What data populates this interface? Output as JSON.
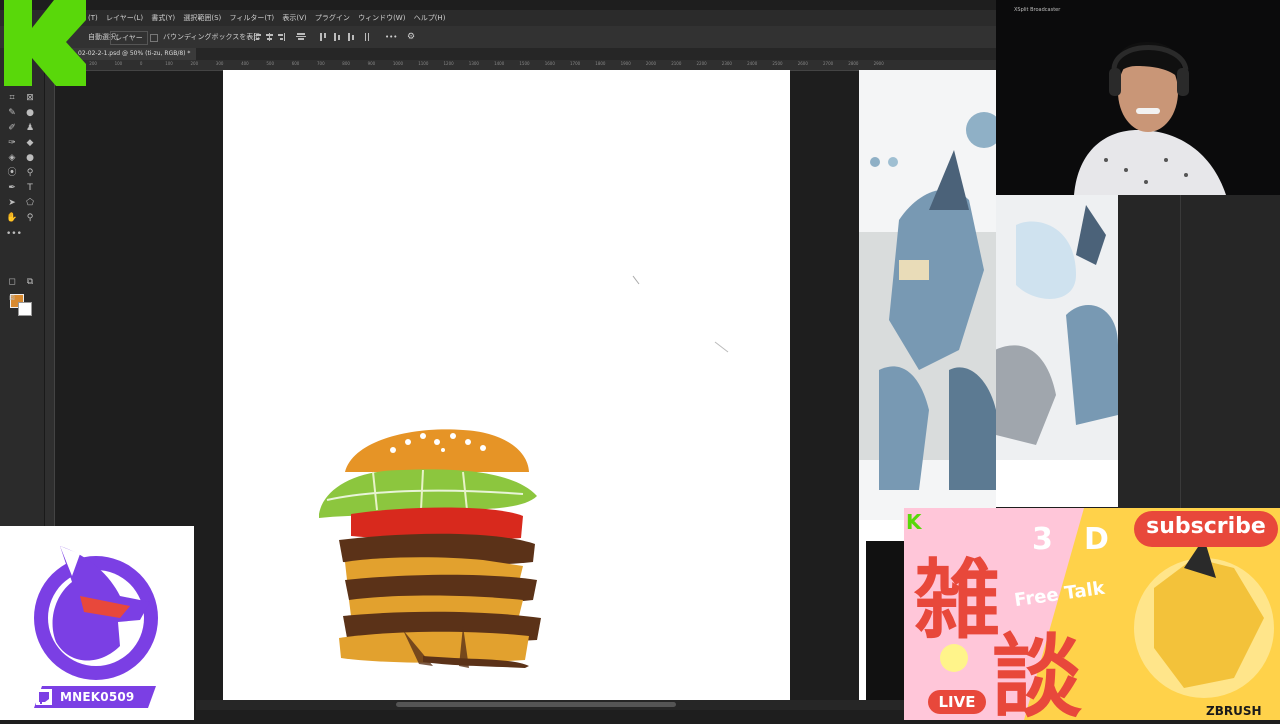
{
  "menu": {
    "items": [
      "(T)",
      "レイヤー(L)",
      "書式(Y)",
      "選択範囲(S)",
      "フィルター(T)",
      "表示(V)",
      "プラグイン",
      "ウィンドウ(W)",
      "ヘルプ(H)"
    ]
  },
  "options_bar": {
    "auto_select_label": "自動選択：",
    "layer_dropdown": "レイヤー",
    "bounding_box_label": "バウンディングボックスを表示",
    "more_label": "•••"
  },
  "document": {
    "tab_title": "02-02-2-1.psd @ 50% (ti-zu, RGB/8) *"
  },
  "ruler": {
    "ticks": [
      "300",
      "200",
      "100",
      "0",
      "100",
      "200",
      "300",
      "400",
      "500",
      "600",
      "700",
      "800",
      "900",
      "1000",
      "1100",
      "1200",
      "1300",
      "1400",
      "1500",
      "1600",
      "1700",
      "1800",
      "1900",
      "2000",
      "2100",
      "2200",
      "2300",
      "2400",
      "2500",
      "2600",
      "2700",
      "2800",
      "2900"
    ]
  },
  "webcam": {
    "watermark": "XSplit Broadcaster"
  },
  "streamer": {
    "handle": "MNEK0509"
  },
  "banner": {
    "subscribe": "subscribe",
    "k": "K",
    "three": "3",
    "d": "D",
    "kanji_1": "雑",
    "kanji_2": "談",
    "free_talk": "Free Talk",
    "live": "LIVE",
    "zbrush": "ZBRUSH"
  },
  "colors": {
    "foreground": "#d88a30",
    "background": "#ffffff",
    "k_green": "#59d80a",
    "twitch_purple": "#7b3fe4",
    "banner_red": "#e8483b",
    "banner_yellow": "#ffd24a"
  }
}
